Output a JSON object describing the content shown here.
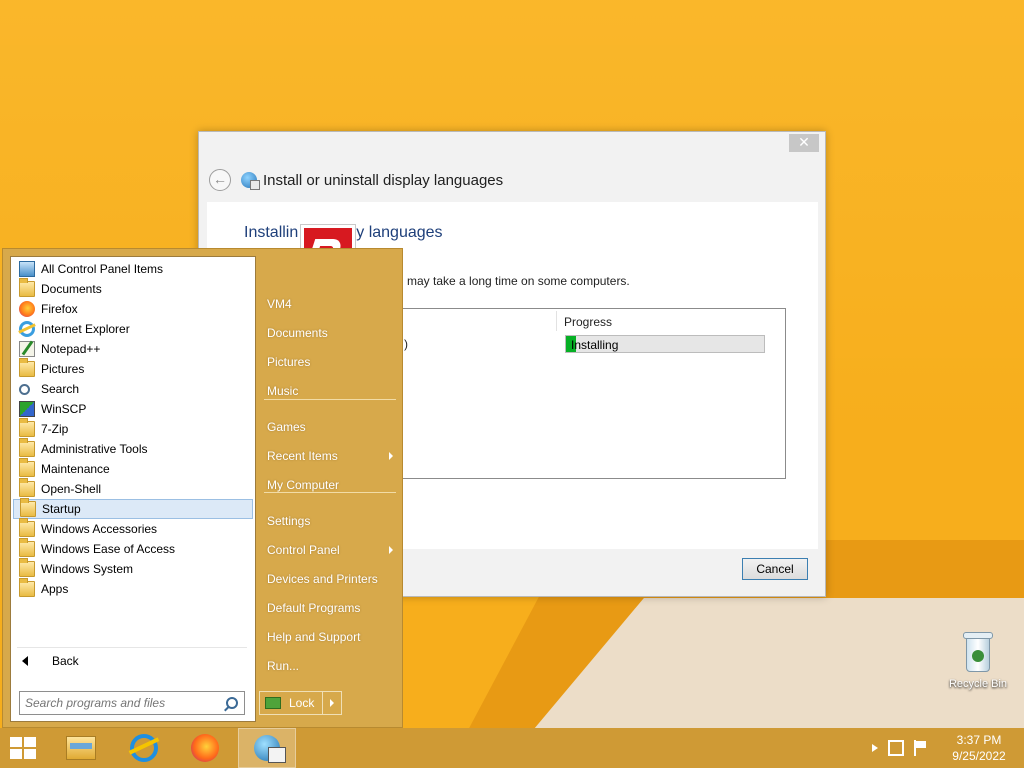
{
  "dialog": {
    "title": "Install or uninstall display languages",
    "close_label": "✕",
    "heading_visible": "Installing display languages",
    "heading_left": "Installin",
    "heading_right": "y languages",
    "note_visible": "may take a long time on some computers.",
    "columns": {
      "progress": "Progress"
    },
    "row": {
      "progress_text": "Installing",
      "progress_fraction": 0.05
    },
    "cancel_label": "Cancel"
  },
  "start_menu": {
    "programs": [
      {
        "label": "All Control Panel Items",
        "icon": "control-panel-icon"
      },
      {
        "label": "Documents",
        "icon": "folder-icon"
      },
      {
        "label": "Firefox",
        "icon": "firefox-icon"
      },
      {
        "label": "Internet Explorer",
        "icon": "internet-explorer-icon"
      },
      {
        "label": "Notepad++",
        "icon": "notepad-icon"
      },
      {
        "label": "Pictures",
        "icon": "folder-icon"
      },
      {
        "label": "Search",
        "icon": "search-icon"
      },
      {
        "label": "WinSCP",
        "icon": "winscp-icon"
      },
      {
        "label": "7-Zip",
        "icon": "folder-icon"
      },
      {
        "label": "Administrative Tools",
        "icon": "folder-icon"
      },
      {
        "label": "Maintenance",
        "icon": "folder-icon"
      },
      {
        "label": "Open-Shell",
        "icon": "folder-icon"
      },
      {
        "label": "Startup",
        "icon": "folder-icon",
        "selected": true
      },
      {
        "label": "Windows Accessories",
        "icon": "folder-icon"
      },
      {
        "label": "Windows Ease of Access",
        "icon": "folder-icon"
      },
      {
        "label": "Windows System",
        "icon": "folder-icon"
      },
      {
        "label": "Apps",
        "icon": "folder-icon"
      }
    ],
    "back_label": "Back",
    "search_placeholder": "Search programs and files",
    "right_items": [
      {
        "label": "VM4"
      },
      {
        "label": "Documents"
      },
      {
        "label": "Pictures"
      },
      {
        "label": "Music"
      },
      {
        "label": "Games"
      },
      {
        "label": "Recent Items",
        "submenu": true
      },
      {
        "label": "My Computer"
      },
      {
        "label": "Settings"
      },
      {
        "label": "Control Panel",
        "submenu": true
      },
      {
        "label": "Devices and Printers"
      },
      {
        "label": "Default Programs"
      },
      {
        "label": "Help and Support"
      },
      {
        "label": "Run..."
      }
    ],
    "lock_label": "Lock"
  },
  "desktop": {
    "recycle_bin_label": "Recycle Bin"
  },
  "taskbar": {
    "time": "3:37 PM",
    "date": "9/25/2022"
  },
  "colors": {
    "desktop": "#f7ae1c",
    "start_menu": "#d7a94b",
    "taskbar": "#cf9a35",
    "progress_fill": "#06b025",
    "heading": "#1e3f7a"
  }
}
